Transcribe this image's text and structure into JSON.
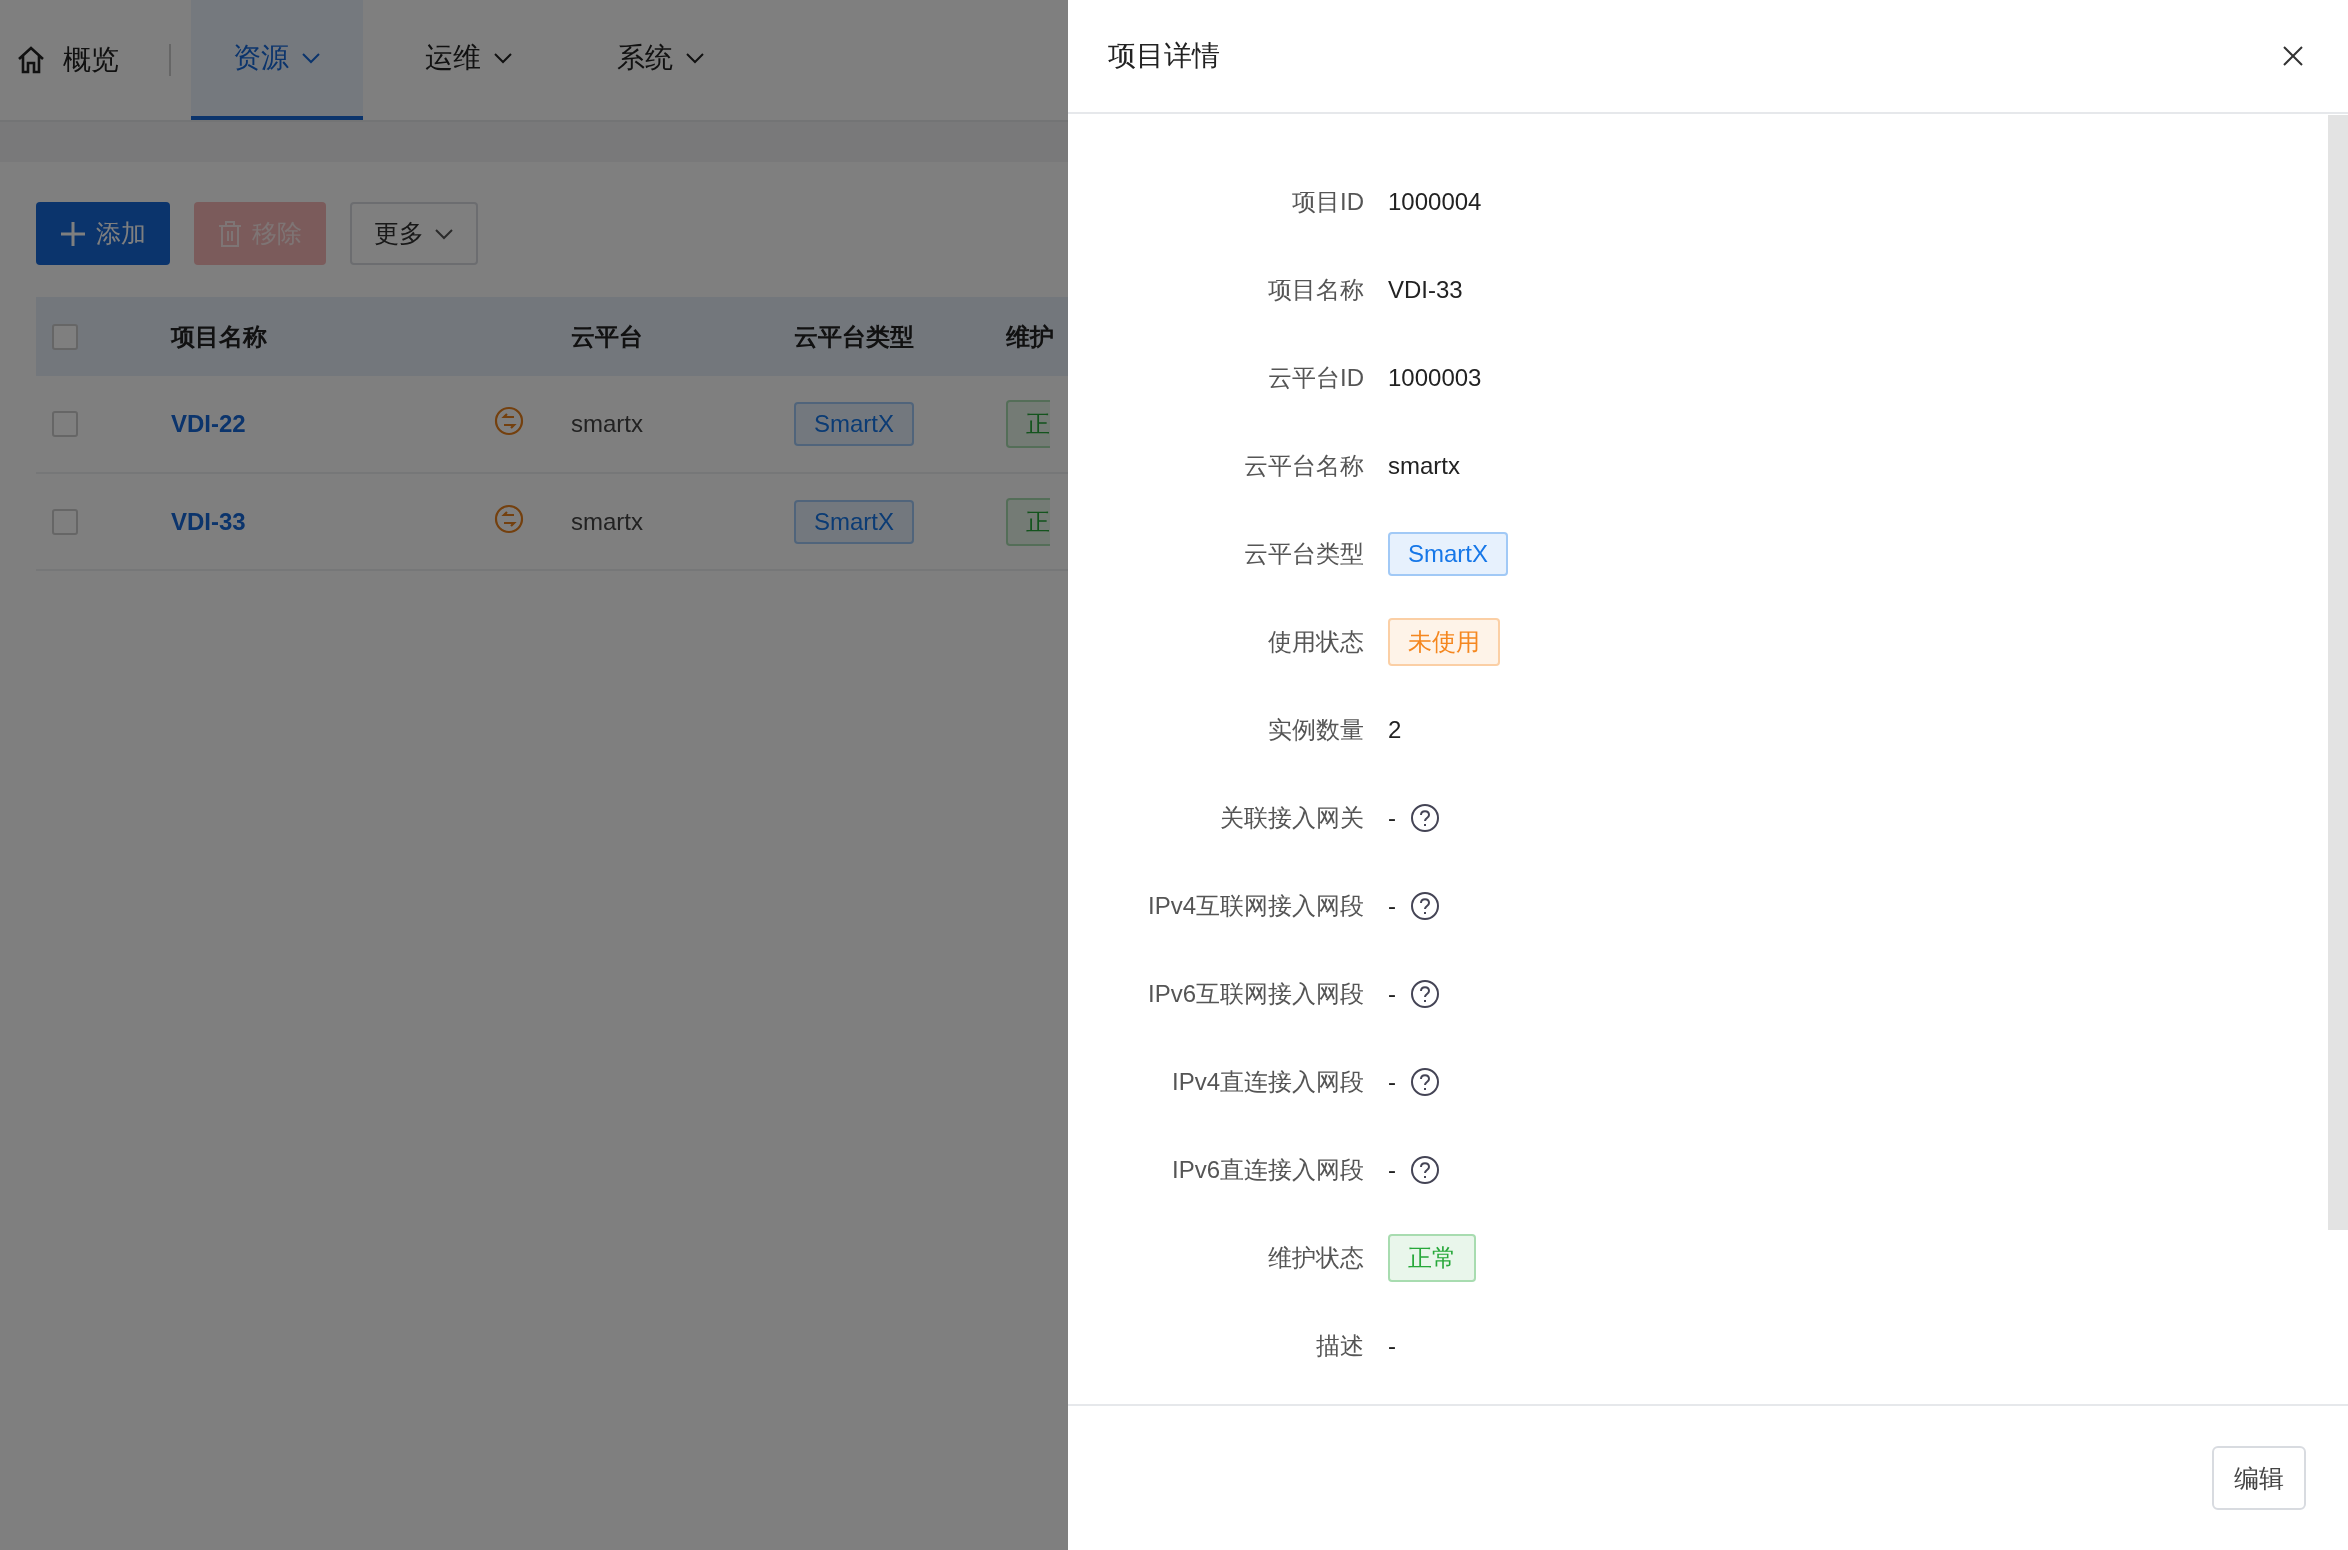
{
  "nav": {
    "home": "概览",
    "tabs": [
      {
        "label": "资源",
        "selected": true
      },
      {
        "label": "运维",
        "selected": false
      },
      {
        "label": "系统",
        "selected": false
      }
    ]
  },
  "toolbar": {
    "add": "添加",
    "remove": "移除",
    "remove_disabled": true,
    "more": "更多"
  },
  "table": {
    "all_checked": false,
    "columns": [
      "项目名称",
      "云平台",
      "云平台类型",
      "维护"
    ],
    "rows": [
      {
        "checked": false,
        "name": "VDI-22",
        "platform": "smartx",
        "type": "SmartX",
        "status": "正"
      },
      {
        "checked": false,
        "name": "VDI-33",
        "platform": "smartx",
        "type": "SmartX",
        "status": "正"
      }
    ]
  },
  "drawer": {
    "title": "项目详情",
    "fields": [
      {
        "kind": "text",
        "label": "项目ID",
        "value": "1000004"
      },
      {
        "kind": "text",
        "label": "项目名称",
        "value": "VDI-33"
      },
      {
        "kind": "text",
        "label": "云平台ID",
        "value": "1000003"
      },
      {
        "kind": "text",
        "label": "云平台名称",
        "value": "smartx"
      },
      {
        "kind": "tag",
        "label": "云平台类型",
        "value": "SmartX",
        "color": "#1677e8"
      },
      {
        "kind": "tag",
        "label": "使用状态",
        "value": "未使用",
        "color": "#f5871f"
      },
      {
        "kind": "text",
        "label": "实例数量",
        "value": "2"
      },
      {
        "kind": "help",
        "label": "关联接入网关",
        "value": "-"
      },
      {
        "kind": "help",
        "label": "IPv4互联网接入网段",
        "value": "-"
      },
      {
        "kind": "help",
        "label": "IPv6互联网接入网段",
        "value": "-"
      },
      {
        "kind": "help",
        "label": "IPv4直连接入网段",
        "value": "-"
      },
      {
        "kind": "help",
        "label": "IPv6直连接入网段",
        "value": "-"
      },
      {
        "kind": "tag",
        "label": "维护状态",
        "value": "正常",
        "color": "#27a83a"
      },
      {
        "kind": "text",
        "label": "描述",
        "value": "-"
      }
    ],
    "edit": "编辑"
  }
}
